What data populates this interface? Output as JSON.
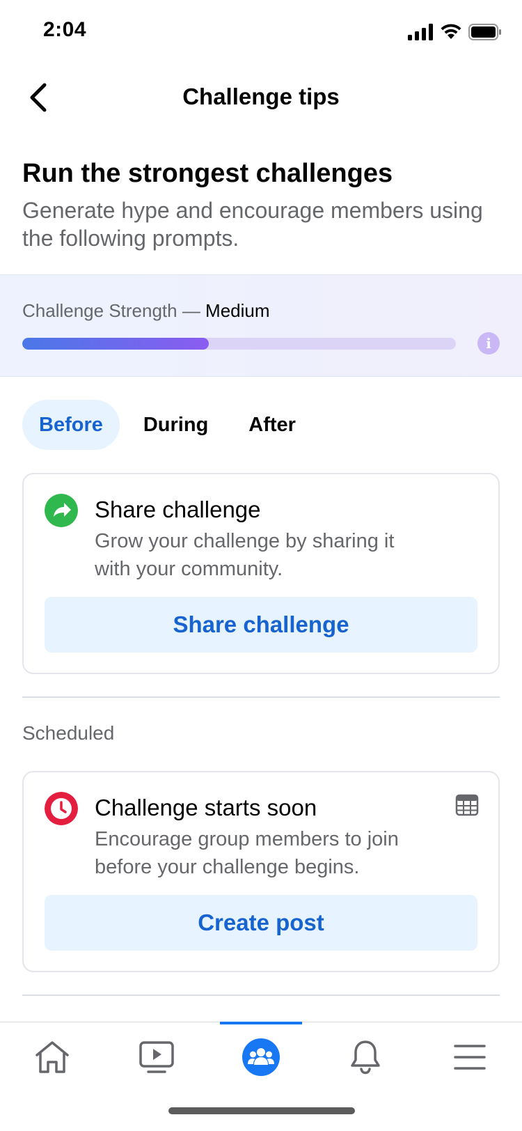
{
  "status_bar": {
    "time": "2:04"
  },
  "header": {
    "title": "Challenge tips"
  },
  "intro": {
    "title": "Run the strongest challenges",
    "subtitle": "Generate hype and encourage members using the following prompts."
  },
  "strength": {
    "label": "Challenge Strength — ",
    "level": "Medium",
    "progress_fraction": 0.43,
    "info_glyph": "i"
  },
  "tabs": [
    {
      "label": "Before",
      "active": true
    },
    {
      "label": "During",
      "active": false
    },
    {
      "label": "After",
      "active": false
    }
  ],
  "cards": {
    "share": {
      "icon": "share-arrow-icon",
      "title": "Share challenge",
      "description": "Grow your challenge by sharing it with your community.",
      "button": "Share challenge"
    },
    "scheduled_label": "Scheduled",
    "starts_soon": {
      "icon": "clock-icon",
      "title": "Challenge starts soon",
      "description": "Encourage group members to join before your challenge begins.",
      "button": "Create post"
    }
  },
  "bottom_nav": {
    "items": [
      "home-icon",
      "video-icon",
      "groups-icon",
      "notifications-icon",
      "menu-icon"
    ],
    "active": "groups-icon"
  },
  "colors": {
    "accent": "#1763cf",
    "accent_bg": "#e7f3ff",
    "share_green": "#2fb84e",
    "clock_red": "#e41e3f",
    "nav_active": "#1877f2"
  }
}
